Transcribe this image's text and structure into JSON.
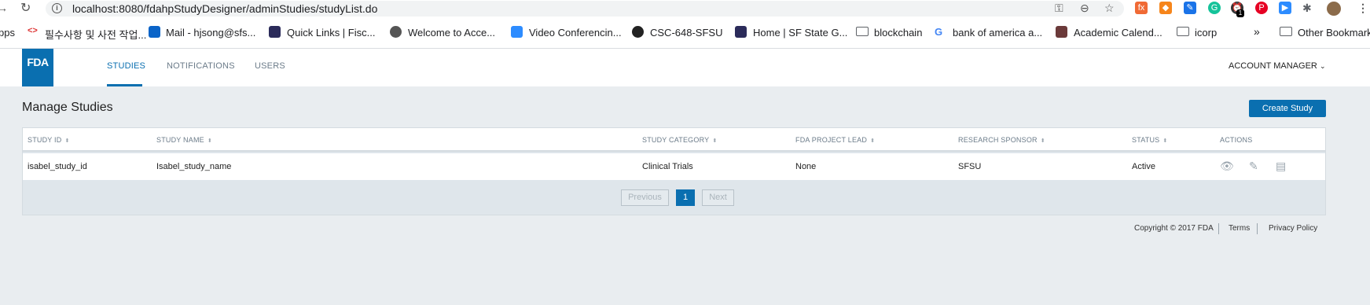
{
  "browser": {
    "url": "localhost:8080/fdahpStudyDesigner/adminStudies/studyList.do",
    "bookmarks": [
      "pps",
      "필수사항 및 사전 작업...",
      "Mail - hjsong@sfs...",
      "Quick Links | Fisc...",
      "Welcome to Acce...",
      "Video Conferencin...",
      "CSC-648-SFSU",
      "Home | SF State G...",
      "blockchain",
      "bank of america a...",
      "Academic Calend...",
      "icorp",
      "Other Bookmark"
    ],
    "overflow_chevron": "»",
    "extension_badge": "1"
  },
  "header": {
    "logo": "FDA",
    "nav": [
      "STUDIES",
      "NOTIFICATIONS",
      "USERS"
    ],
    "account": "ACCOUNT MANAGER"
  },
  "page": {
    "title": "Manage Studies",
    "create_button": "Create Study"
  },
  "table": {
    "columns": [
      "STUDY ID",
      "STUDY NAME",
      "STUDY CATEGORY",
      "FDA PROJECT LEAD",
      "RESEARCH SPONSOR",
      "STATUS",
      "ACTIONS"
    ],
    "rows": [
      [
        "isabel_study_id",
        "Isabel_study_name",
        "Clinical Trials",
        "None",
        "SFSU",
        "Active"
      ]
    ]
  },
  "pagination": {
    "previous": "Previous",
    "current": "1",
    "next": "Next"
  },
  "footer": {
    "copyright": "Copyright © 2017 FDA",
    "terms": "Terms",
    "privacy": "Privacy Policy"
  },
  "colors": {
    "primary": "#0a6fb0",
    "background": "#e9edf0"
  }
}
